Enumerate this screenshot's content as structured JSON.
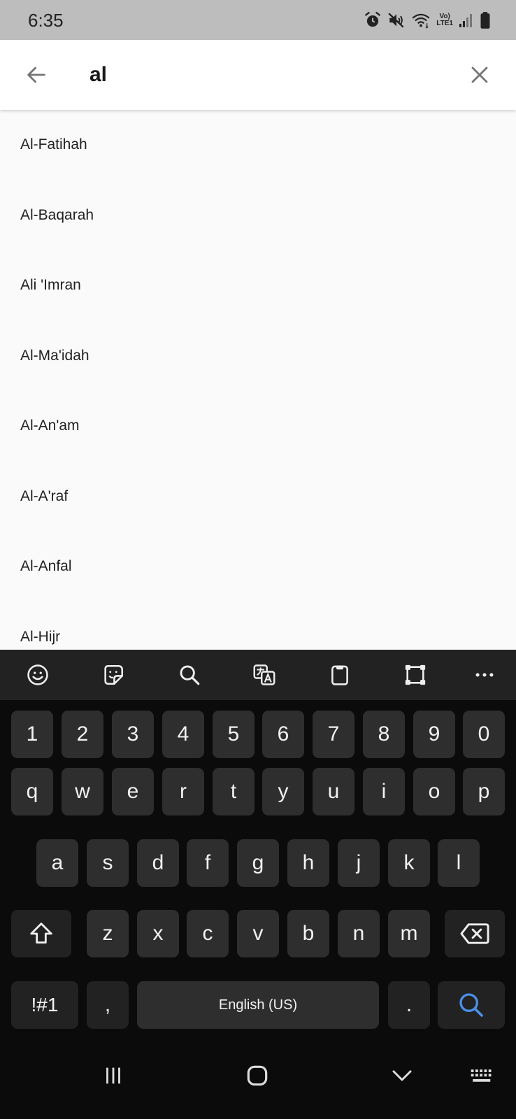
{
  "status_bar": {
    "time": "6:35",
    "volte_top": "Vo)",
    "volte_bottom": "LTE1",
    "icons": [
      "alarm-icon",
      "mute-icon",
      "wifi-icon",
      "signal-icon",
      "battery-icon"
    ]
  },
  "search": {
    "query": "al",
    "back_icon": "arrow-left-icon",
    "clear_icon": "close-icon"
  },
  "results": [
    "Al-Fatihah",
    "Al-Baqarah",
    "Ali 'Imran",
    "Al-Ma'idah",
    "Al-An'am",
    "Al-A'raf",
    "Al-Anfal",
    "Al-Hijr"
  ],
  "keyboard": {
    "toolbar_icons": [
      "emoji-icon",
      "sticker-icon",
      "search-icon",
      "translate-icon",
      "clipboard-icon",
      "resize-icon",
      "more-icon"
    ],
    "rows": [
      [
        "1",
        "2",
        "3",
        "4",
        "5",
        "6",
        "7",
        "8",
        "9",
        "0"
      ],
      [
        "q",
        "w",
        "e",
        "r",
        "t",
        "y",
        "u",
        "i",
        "o",
        "p"
      ],
      [
        "a",
        "s",
        "d",
        "f",
        "g",
        "h",
        "j",
        "k",
        "l"
      ],
      [
        "z",
        "x",
        "c",
        "v",
        "b",
        "n",
        "m"
      ]
    ],
    "symbols_label": "!#1",
    "comma_label": ",",
    "space_label": "English (US)",
    "period_label": ".",
    "accent_color": "#4a8fe7"
  },
  "nav_bar": {
    "icons": [
      "recent-apps-icon",
      "home-icon",
      "hide-keyboard-icon",
      "keyboard-switch-icon"
    ]
  }
}
